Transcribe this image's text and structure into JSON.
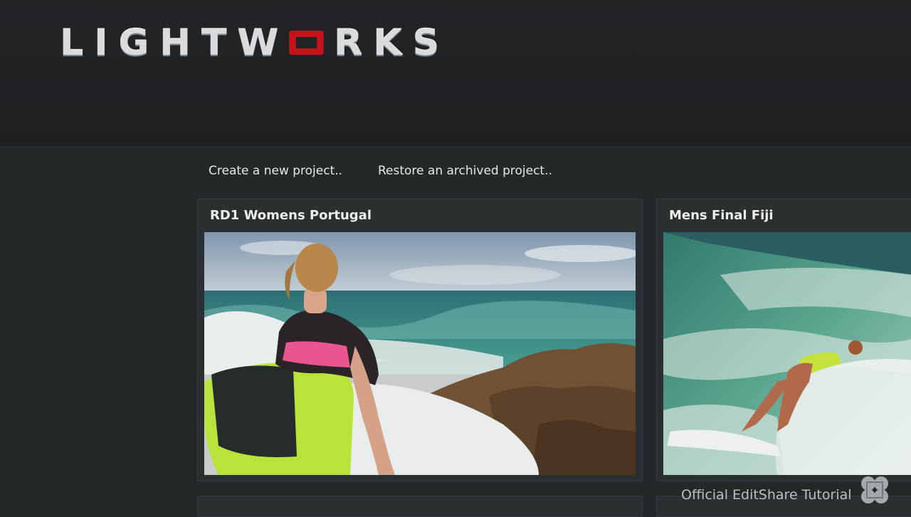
{
  "app": {
    "logo_text_left": "LIGHTW",
    "logo_accent": "O",
    "logo_text_right": "RKS",
    "accent_color": "#c8121b"
  },
  "actions": {
    "create_label": "Create a new project..",
    "restore_label": "Restore an archived project.."
  },
  "projects": [
    {
      "title": "RD1 Womens Portugal"
    },
    {
      "title": "Mens Final Fiji"
    }
  ],
  "watermark": {
    "text": "Official EditShare Tutorial",
    "icon": "editshare-logo-icon"
  }
}
